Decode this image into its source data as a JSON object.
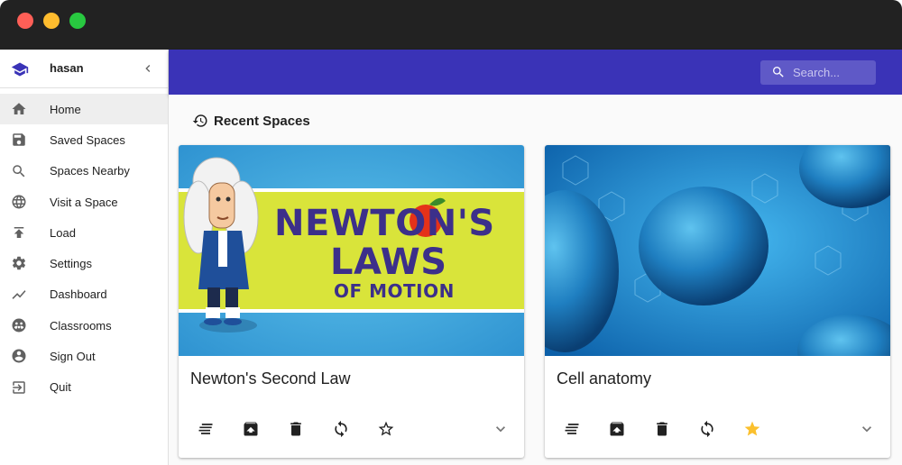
{
  "window": {
    "title_dots": [
      "close",
      "minimize",
      "maximize"
    ]
  },
  "sidebar": {
    "user": "hasan",
    "header_icon": "graduation-cap-icon",
    "items": [
      {
        "label": "Home",
        "icon": "home-icon",
        "active": true
      },
      {
        "label": "Saved Spaces",
        "icon": "save-icon",
        "active": false
      },
      {
        "label": "Spaces Nearby",
        "icon": "search-icon",
        "active": false
      },
      {
        "label": "Visit a Space",
        "icon": "globe-icon",
        "active": false
      },
      {
        "label": "Load",
        "icon": "upload-icon",
        "active": false
      },
      {
        "label": "Settings",
        "icon": "gear-icon",
        "active": false
      },
      {
        "label": "Dashboard",
        "icon": "trending-icon",
        "active": false
      },
      {
        "label": "Classrooms",
        "icon": "classroom-icon",
        "active": false
      },
      {
        "label": "Sign Out",
        "icon": "account-icon",
        "active": false
      },
      {
        "label": "Quit",
        "icon": "exit-icon",
        "active": false
      }
    ]
  },
  "appbar": {
    "color": "#3a33b7",
    "search": {
      "placeholder": "Search...",
      "value": ""
    }
  },
  "main": {
    "section_title": "Recent Spaces",
    "section_icon": "history-icon",
    "cards": [
      {
        "title": "Newton's Second Law",
        "image": "newtons-laws-of-motion-thumbnail",
        "image_text": [
          "NEWTON'S",
          "LAWS",
          "OF MOTION"
        ],
        "starred": false,
        "actions": [
          "details-icon",
          "archive-icon",
          "delete-icon",
          "sync-icon",
          "star-outline-icon",
          "chevron-down-icon"
        ]
      },
      {
        "title": "Cell anatomy",
        "image": "cell-anatomy-thumbnail",
        "starred": true,
        "actions": [
          "details-icon",
          "archive-icon",
          "delete-icon",
          "sync-icon",
          "star-filled-icon",
          "chevron-down-icon"
        ]
      }
    ]
  },
  "colors": {
    "accent": "#3a33b7",
    "star": "#fbc02d",
    "icon": "#616161"
  }
}
